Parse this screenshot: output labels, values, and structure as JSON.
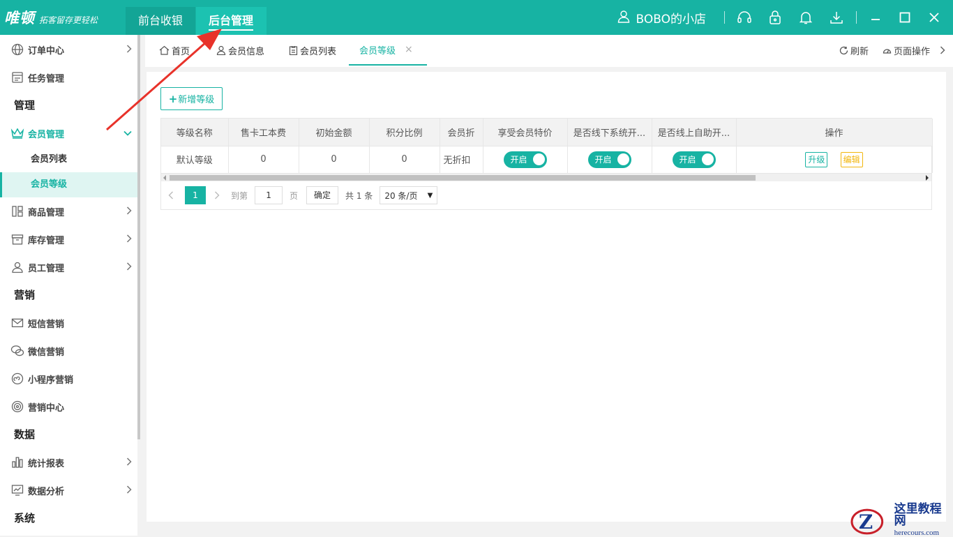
{
  "header": {
    "logo_main": "唯顿",
    "logo_slogan": "拓客留存更轻松",
    "tabs": [
      "前台收银",
      "后台管理"
    ],
    "store_name": "BOBO的小店",
    "icons": [
      "headset-icon",
      "lock-icon",
      "bell-icon",
      "download-icon",
      "minimize-icon",
      "maximize-icon",
      "close-icon"
    ]
  },
  "sidebar": {
    "items": [
      {
        "label": "订单中心",
        "icon": "globe-icon"
      },
      {
        "label": "任务管理",
        "icon": "task-icon"
      },
      {
        "group": "管理"
      },
      {
        "label": "会员管理",
        "icon": "crown-icon"
      },
      {
        "sub": "会员列表"
      },
      {
        "sub": "会员等级"
      },
      {
        "label": "商品管理",
        "icon": "goods-icon"
      },
      {
        "label": "库存管理",
        "icon": "inventory-icon"
      },
      {
        "label": "员工管理",
        "icon": "user-icon"
      },
      {
        "group": "营销"
      },
      {
        "label": "短信营销",
        "icon": "mail-icon"
      },
      {
        "label": "微信营销",
        "icon": "wechat-icon"
      },
      {
        "label": "小程序营销",
        "icon": "miniapp-icon"
      },
      {
        "label": "营销中心",
        "icon": "target-icon"
      },
      {
        "group": "数据"
      },
      {
        "label": "统计报表",
        "icon": "bar-chart-icon"
      },
      {
        "label": "数据分析",
        "icon": "analysis-icon"
      },
      {
        "group": "系统"
      }
    ]
  },
  "tabs": {
    "items": [
      "首页",
      "会员信息",
      "会员列表",
      "会员等级"
    ],
    "close_symbol": "×",
    "refresh": "刷新",
    "page_ops": "页面操作"
  },
  "toolbar": {
    "add_label": "新增等级"
  },
  "table": {
    "headers": [
      "等级名称",
      "售卡工本费",
      "初始金额",
      "积分比例",
      "会员折",
      "享受会员特价",
      "是否线下系统开...",
      "是否线上自助开...",
      "操作"
    ],
    "row": {
      "name": "默认等级",
      "card_fee": "0",
      "initial_amount": "0",
      "points_ratio": "0",
      "discount": "无折扣",
      "switch_label": "开启",
      "op_upgrade": "升级",
      "op_edit": "编辑"
    }
  },
  "pager": {
    "current_page": "1",
    "goto_label": "到第",
    "goto_value": "1",
    "page_unit": "页",
    "confirm": "确定",
    "total": "共 1 条",
    "page_size": "20 条/页"
  },
  "watermark": {
    "cn": "这里教程网",
    "en": "herecours.com"
  },
  "colors": {
    "accent": "#17b3a3",
    "edit": "#f2b60d",
    "annotation": "#e8322a"
  }
}
